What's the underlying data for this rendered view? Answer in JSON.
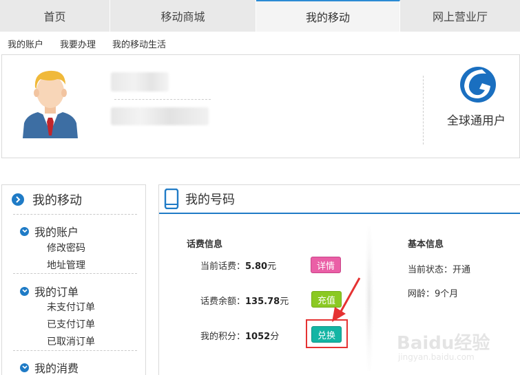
{
  "nav": {
    "tabs": [
      {
        "label": "首页"
      },
      {
        "label": "移动商城"
      },
      {
        "label": "我的移动"
      },
      {
        "label": "网上营业厅"
      }
    ]
  },
  "subnav": {
    "items": [
      {
        "label": "我的账户"
      },
      {
        "label": "我要办理"
      },
      {
        "label": "我的移动生活"
      }
    ]
  },
  "profile": {
    "user_type": "全球通用户"
  },
  "sidebar": {
    "title": "我的移动",
    "sections": [
      {
        "label": "我的账户",
        "items": [
          "修改密码",
          "地址管理"
        ]
      },
      {
        "label": "我的订单",
        "items": [
          "未支付订单",
          "已支付订单",
          "已取消订单"
        ]
      },
      {
        "label": "我的消费",
        "items": []
      }
    ]
  },
  "main": {
    "title": "我的号码",
    "fee": {
      "heading": "话费信息",
      "current_label": "当前话费：",
      "current_value": "5.80",
      "current_unit": "元",
      "balance_label": "话费余额：",
      "balance_value": "135.78",
      "balance_unit": "元",
      "points_label": "我的积分：",
      "points_value": "1052",
      "points_unit": "分",
      "detail_button": "详情",
      "recharge_button": "充值",
      "exchange_button": "兑换"
    },
    "basic": {
      "heading": "基本信息",
      "status": "当前状态：开通",
      "age": "网龄：9个月"
    }
  },
  "watermark": {
    "text": "Baidu经验",
    "sub": "jingyan.baidu.com"
  },
  "colors": {
    "accent": "#1f7bc6",
    "detail": "#ea5fa6",
    "recharge": "#8bc923",
    "exchange": "#14b5a4",
    "highlight": "#e53232"
  }
}
